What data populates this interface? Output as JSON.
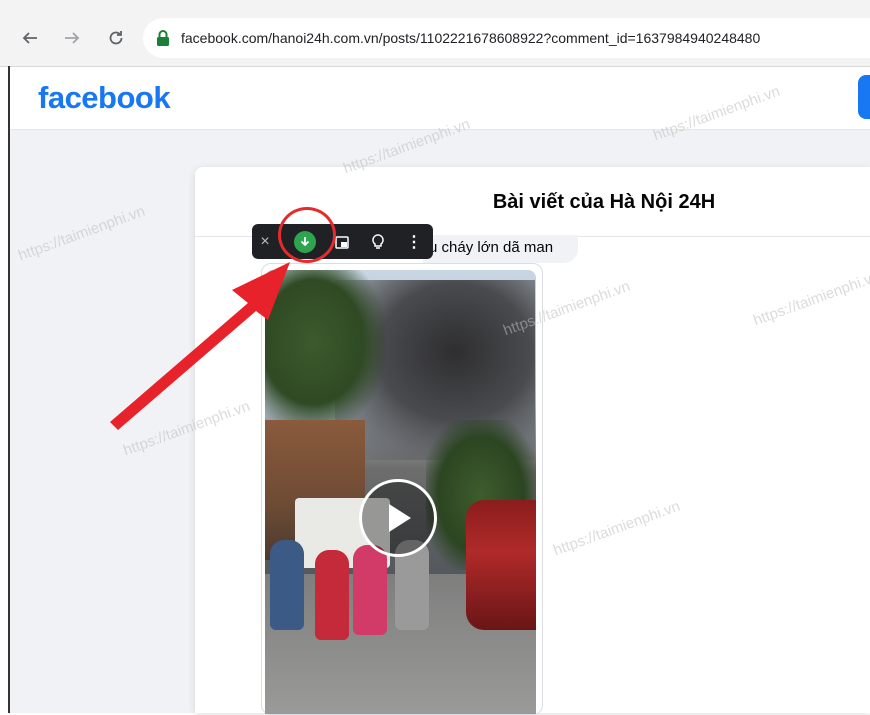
{
  "browser": {
    "url": "facebook.com/hanoi24h.com.vn/posts/1102221678608922?comment_id=1637984940248480",
    "back_icon": "arrow-left-icon",
    "forward_icon": "arrow-right-icon",
    "reload_icon": "reload-icon"
  },
  "facebook": {
    "logo_text": "facebook",
    "brand_color": "#1877f2"
  },
  "post_dialog": {
    "title": "Bài viết của Hà Nội 24H",
    "comment_text": "u cháy lớn dã man"
  },
  "video_toolbar": {
    "close_label": "×",
    "more_label": "⋮",
    "download_icon": "download-icon",
    "pip_icon": "picture-in-picture-icon",
    "tip_icon": "lightbulb-icon",
    "download_color": "#2ea44f"
  },
  "annotation": {
    "highlight_color": "#e52b2b"
  },
  "watermark_text": "https://taimienphi.vn"
}
